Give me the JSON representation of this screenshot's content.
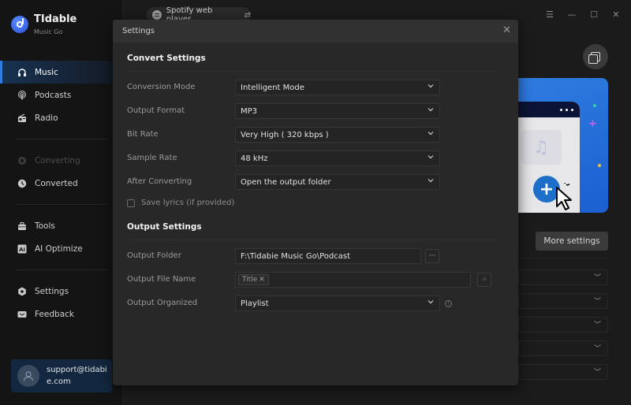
{
  "app": {
    "name": "TIdable",
    "subtitle": "Music Go"
  },
  "source": {
    "label": "Spotify web player",
    "icon": "spotify-icon",
    "swap_icon": "swap-icon"
  },
  "window_controls": {
    "menu": "☰",
    "minimize": "—",
    "maximize": "☐",
    "close": "✕"
  },
  "sidebar": {
    "items": [
      {
        "label": "Music",
        "icon": "headphones-icon",
        "glyph": "🎧",
        "state": "active"
      },
      {
        "label": "Podcasts",
        "icon": "podcast-icon",
        "glyph": "◉",
        "state": "normal"
      },
      {
        "label": "Radio",
        "icon": "radio-icon",
        "glyph": "📻",
        "state": "normal"
      },
      {
        "label": "Converting",
        "icon": "converting-icon",
        "glyph": "◎",
        "state": "disabled"
      },
      {
        "label": "Converted",
        "icon": "clock-icon",
        "glyph": "◷",
        "state": "normal"
      },
      {
        "label": "Tools",
        "icon": "toolbox-icon",
        "glyph": "▣",
        "state": "normal"
      },
      {
        "label": "AI Optimize",
        "icon": "ai-icon",
        "glyph": "Ai",
        "state": "normal"
      },
      {
        "label": "Settings",
        "icon": "gear-icon",
        "glyph": "⬢",
        "state": "normal"
      },
      {
        "label": "Feedback",
        "icon": "mail-icon",
        "glyph": "✉",
        "state": "normal"
      }
    ]
  },
  "account": {
    "email": "support@tidabie.com"
  },
  "main": {
    "more_settings_label": "More settings"
  },
  "settings_dialog": {
    "title": "Settings",
    "close_glyph": "✕",
    "convert_section": {
      "title": "Convert Settings",
      "rows": [
        {
          "label": "Conversion Mode",
          "value": "Intelligent Mode"
        },
        {
          "label": "Output Format",
          "value": "MP3"
        },
        {
          "label": "Bit Rate",
          "value": "Very High ( 320 kbps )"
        },
        {
          "label": "Sample Rate",
          "value": "48 kHz"
        },
        {
          "label": "After Converting",
          "value": "Open the output folder"
        }
      ],
      "save_lyrics": {
        "label": "Save lyrics (if provided)",
        "checked": false
      }
    },
    "output_section": {
      "title": "Output Settings",
      "folder": {
        "label": "Output Folder",
        "value": "F:\\Tidabie Music Go\\Podcast",
        "browse_glyph": "···"
      },
      "file_name": {
        "label": "Output File Name",
        "tags": [
          "Title"
        ],
        "tag_remove_glyph": "✕",
        "add_glyph": "+"
      },
      "organized": {
        "label": "Output Organized",
        "value": "Playlist",
        "info_glyph": "!"
      }
    }
  }
}
